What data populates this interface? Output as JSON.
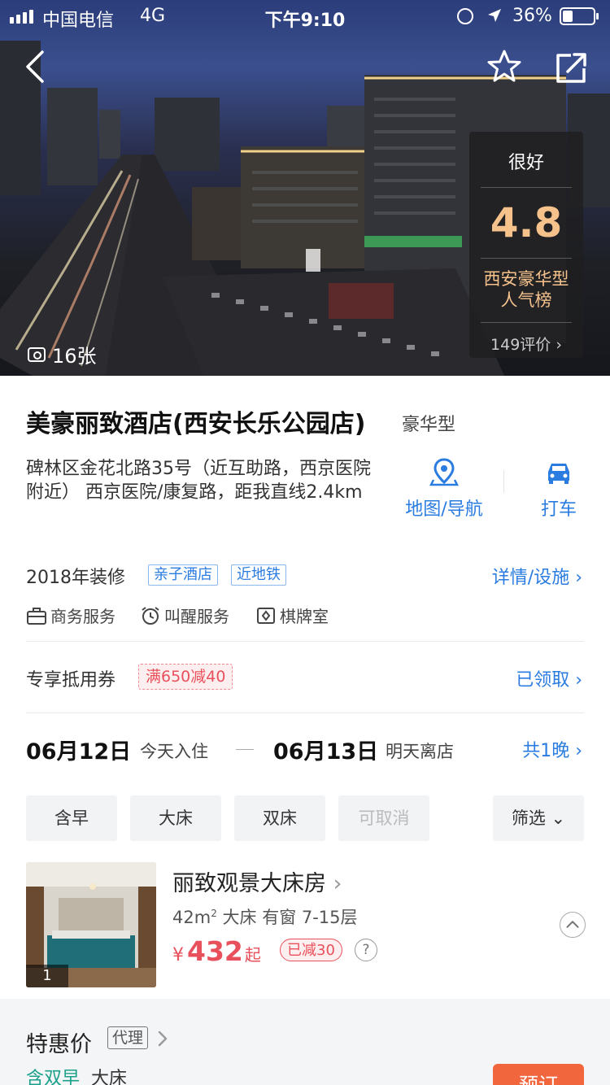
{
  "status_bar": {
    "carrier": "中国电信",
    "network": "4G",
    "time": "下午9:10",
    "battery": "36%"
  },
  "hero": {
    "photo_count": "16张",
    "rating": {
      "label": "很好",
      "score": "4.8",
      "rank": "西安豪华型人气榜",
      "reviews": "149评价"
    }
  },
  "hotel": {
    "name": "美豪丽致酒店(西安长乐公园店)",
    "type": "豪华型",
    "address": "碑林区金花北路35号（近互助路，西京医院附近） 西京医院/康复路，距我直线2.4km",
    "renovation": "2018年装修",
    "tags": [
      "亲子酒店",
      "近地铁"
    ],
    "details_link": "详情/设施",
    "facilities": [
      "商务服务",
      "叫醒服务",
      "棋牌室"
    ]
  },
  "actions": {
    "map": "地图/导航",
    "taxi": "打车"
  },
  "coupon": {
    "label": "专享抵用券",
    "badge": "满650减40",
    "status": "已领取"
  },
  "dates": {
    "checkin_date": "06月12日",
    "checkin_label": "今天入住",
    "checkout_date": "06月13日",
    "checkout_label": "明天离店",
    "nights": "共1晚"
  },
  "filters": {
    "items": [
      "含早",
      "大床",
      "双床",
      "可取消"
    ],
    "more": "筛选"
  },
  "room": {
    "name": "丽致观景大床房",
    "area_value": "42m",
    "area_sup": "2",
    "specs": "大床  有窗  7-15层",
    "currency": "¥",
    "price": "432",
    "price_suffix": "起",
    "discount": "已减30",
    "help": "?",
    "photo_index": "1"
  },
  "deal": {
    "title": "特惠价",
    "agent": "代理",
    "meal": "含双早",
    "bed": "大床",
    "book": "预订"
  },
  "colors": {
    "accent": "#2a7ce0",
    "price_red": "#e8505b",
    "score_gold": "#f6c28c",
    "book_orange": "#f2663d",
    "meal_green": "#1aa18a"
  }
}
